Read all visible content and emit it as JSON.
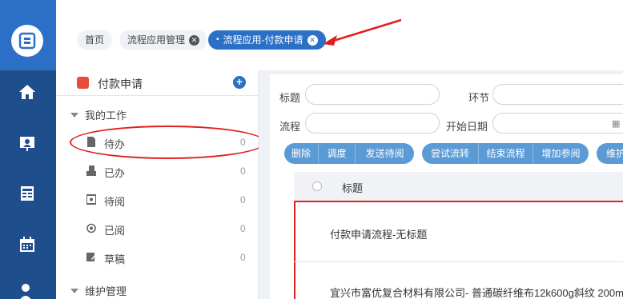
{
  "tabs": [
    {
      "label": "首页",
      "closable": false,
      "active": false
    },
    {
      "label": "流程应用管理",
      "closable": true,
      "active": false
    },
    {
      "label": "流程应用-付款申请",
      "closable": true,
      "active": true
    }
  ],
  "tree": {
    "title": "付款申请",
    "groups": [
      {
        "label": "我的工作",
        "expanded": true
      },
      {
        "label": "维护管理",
        "expanded": true
      }
    ],
    "items": [
      {
        "label": "待办",
        "count": "0",
        "icon": "file-icon"
      },
      {
        "label": "已办",
        "count": "0",
        "icon": "stamp-icon"
      },
      {
        "label": "待阅",
        "count": "0",
        "icon": "view-icon"
      },
      {
        "label": "已阅",
        "count": "0",
        "icon": "eye-icon"
      },
      {
        "label": "草稿",
        "count": "0",
        "icon": "edit-icon"
      }
    ]
  },
  "filters": {
    "title_label": "标题",
    "step_label": "环节",
    "flow_label": "流程",
    "start_date_label": "开始日期"
  },
  "toolbar": {
    "delete": "删除",
    "transfer": "调度",
    "send_read": "发送待阅",
    "try_flow": "尝试流转",
    "end_flow": "结束流程",
    "add_reader": "增加参阅",
    "maintain": "维护"
  },
  "table": {
    "header_title": "标题",
    "rows": [
      {
        "title": "付款申请流程-无标题"
      },
      {
        "title": "宜兴市富优复合材料有限公司- 普通碳纤维布12k600g斜纹 200m"
      }
    ]
  },
  "colors": {
    "rail": "#1f4e8c",
    "rail_top": "#2c6fc6",
    "accent": "#2c6fc6",
    "button": "#5b9bd5",
    "annotation": "#e02020"
  }
}
